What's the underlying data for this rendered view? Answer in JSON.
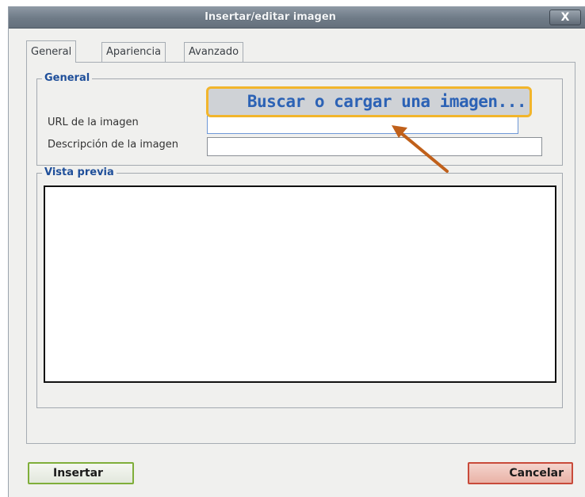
{
  "dialog": {
    "title": "Insertar/editar imagen",
    "close_label": "X"
  },
  "tabs": [
    {
      "label": "General",
      "active": true
    },
    {
      "label": "Apariencia",
      "active": false
    },
    {
      "label": "Avanzado",
      "active": false
    }
  ],
  "general_section": {
    "legend": "General",
    "url_label": "URL de la imagen",
    "url_value": "",
    "description_label": "Descripción de la imagen",
    "description_value": ""
  },
  "callout": {
    "text": "Buscar o cargar una imagen...",
    "border_color": "#f2b52b",
    "arrow_color": "#c0601a"
  },
  "preview_section": {
    "legend": "Vista previa"
  },
  "buttons": {
    "insert_label": "Insertar",
    "cancel_label": "Cancelar"
  },
  "colors": {
    "legend_text": "#1f4f9a",
    "insert_border": "#7fae3a",
    "cancel_border": "#c84a3a"
  }
}
